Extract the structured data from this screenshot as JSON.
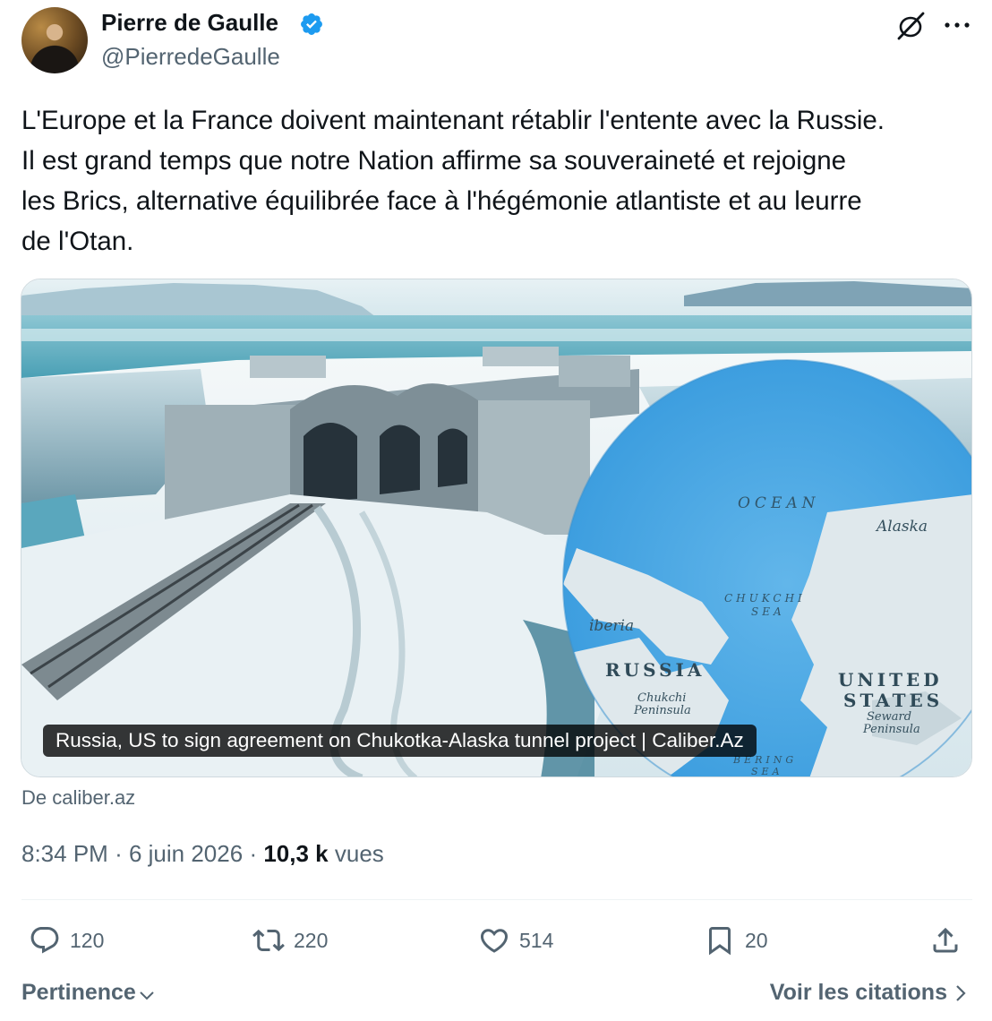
{
  "author": {
    "name": "Pierre de Gaulle",
    "handle": "@PierredeGaulle",
    "verified": true
  },
  "tweet": {
    "text": "L'Europe et la France doivent maintenant rétablir l'entente avec la Russie.\nIl est grand temps que notre Nation affirme sa souveraineté et rejoigne\nles Brics, alternative équilibrée face à l'hégémonie atlantiste et au leurre\nde l'Otan."
  },
  "card": {
    "caption": "Russia, US to sign agreement on Chukotka-Alaska tunnel project | Caliber.Az",
    "map_labels": {
      "ocean": "OCEAN",
      "alaska": "Alaska",
      "chukchi_sea_1": "CHUKCHI",
      "chukchi_sea_2": "SEA",
      "siberia": "iberia",
      "russia": "RUSSIA",
      "united": "UNITED",
      "states": "STATES",
      "chukchi_pen_1": "Chukchi",
      "chukchi_pen_2": "Peninsula",
      "seward_1": "Seward",
      "seward_2": "Peninsula",
      "bering": "BERING",
      "sea": "SEA"
    }
  },
  "source": "De caliber.az",
  "meta": {
    "time": "8:34 PM",
    "separator": "·",
    "date": "6 juin 2026",
    "views_count": "10,3 k",
    "views_label": "vues"
  },
  "actions": {
    "replies": "120",
    "reposts": "220",
    "likes": "514",
    "bookmarks": "20"
  },
  "footer": {
    "sort_label": "Pertinence",
    "quotes_label": "Voir les citations"
  },
  "icons": [
    "verified-icon",
    "grok-icon",
    "more-icon",
    "reply-icon",
    "repost-icon",
    "like-icon",
    "bookmark-icon",
    "share-icon",
    "chevron-down-icon",
    "chevron-right-icon"
  ],
  "colors": {
    "text": "#0f1419",
    "secondary": "#536471",
    "verified": "#1d9bf0"
  }
}
